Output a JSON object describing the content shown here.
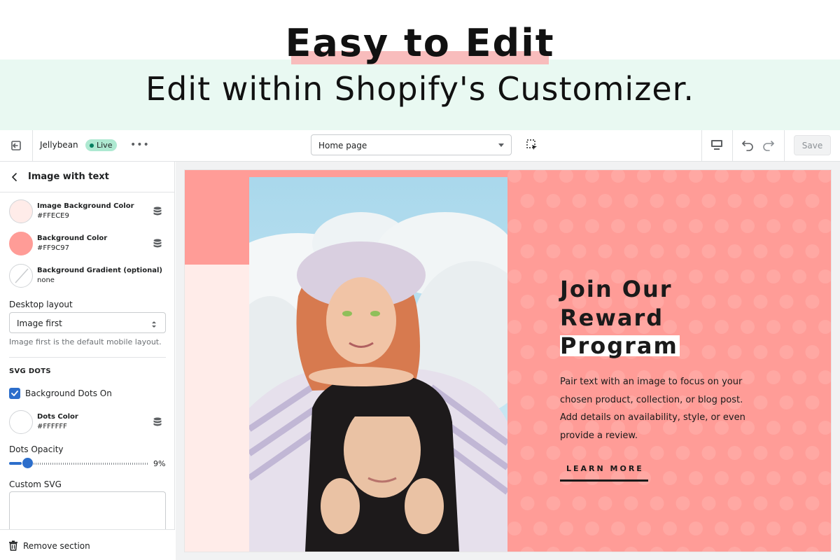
{
  "hero": {
    "title": "Easy to Edit",
    "subtitle": "Edit within Shopify's Customizer."
  },
  "toolbar": {
    "store_name": "Jellybean",
    "status": "Live",
    "page_select": "Home page",
    "save_label": "Save"
  },
  "sidebar": {
    "title": "Image with text",
    "colors": [
      {
        "name": "Image Background Color",
        "value": "#FFECE9",
        "swatch": "#ffece9"
      },
      {
        "name": "Background Color",
        "value": "#FF9C97",
        "swatch": "#ff9c97"
      },
      {
        "name": "Background Gradient (optional)",
        "value": "none",
        "swatch": "none"
      }
    ],
    "desktop_layout_label": "Desktop layout",
    "desktop_layout_value": "Image first",
    "desktop_layout_help": "Image first is the default mobile layout.",
    "svg_section_heading": "SVG DOTS",
    "dots_checkbox_label": "Background Dots On",
    "dots_checkbox_checked": true,
    "dots_color": {
      "name": "Dots Color",
      "value": "#FFFFFF",
      "swatch": "#ffffff"
    },
    "dots_opacity_label": "Dots Opacity",
    "dots_opacity_value": "9%",
    "dots_opacity_fraction": 0.09,
    "custom_svg_label": "Custom SVG",
    "remove_label": "Remove section"
  },
  "preview": {
    "heading_lines": [
      "Join Our",
      "Reward",
      "Program"
    ],
    "body": "Pair text with an image to focus on your chosen product, collection, or blog post. Add details on availability, style, or even provide a review.",
    "cta": "LEARN MORE"
  },
  "colors": {
    "accent": "#2c6ecb",
    "live_badge": "#aee9d1",
    "preview_bg": "#ff9c97",
    "preview_pale": "#ffece9",
    "hero_band": "#e9f9f2",
    "hero_highlight": "#f8bcbc"
  }
}
